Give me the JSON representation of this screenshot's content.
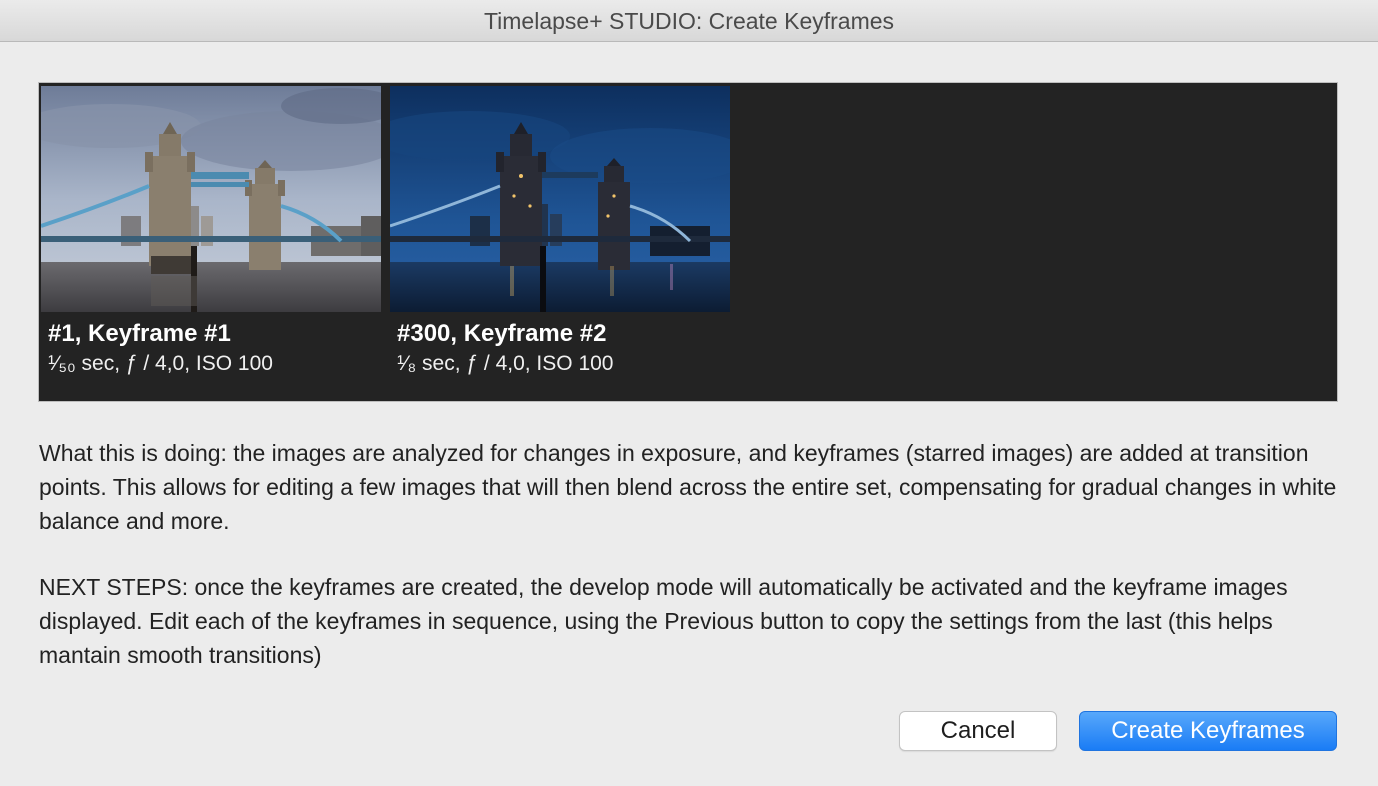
{
  "window": {
    "title": "Timelapse+ STUDIO: Create Keyframes"
  },
  "keyframes": [
    {
      "title": "#1, Keyframe #1",
      "meta": "¹⁄₅₀ sec, ƒ / 4,0, ISO 100",
      "photo": "tower-bridge-dusk"
    },
    {
      "title": "#300, Keyframe #2",
      "meta": "¹⁄₈ sec, ƒ / 4,0, ISO 100",
      "photo": "tower-bridge-night"
    }
  ],
  "description": {
    "paragraph1": "What this is doing: the images are analyzed for changes in exposure, and keyframes (starred images) are added at transition points.  This allows for editing a few images that will then blend across the entire set, compensating for gradual changes in white balance and more.",
    "paragraph2": "NEXT STEPS: once the keyframes are created, the develop mode will automatically be activated and the keyframe images displayed.  Edit each of the keyframes in sequence, using the Previous button to copy the settings from the last (this helps mantain smooth transitions)"
  },
  "buttons": {
    "cancel_label": "Cancel",
    "create_label": "Create Keyframes"
  },
  "colors": {
    "strip_background": "#232323",
    "primary_button": "#1a7cf5",
    "window_background": "#ececec"
  }
}
